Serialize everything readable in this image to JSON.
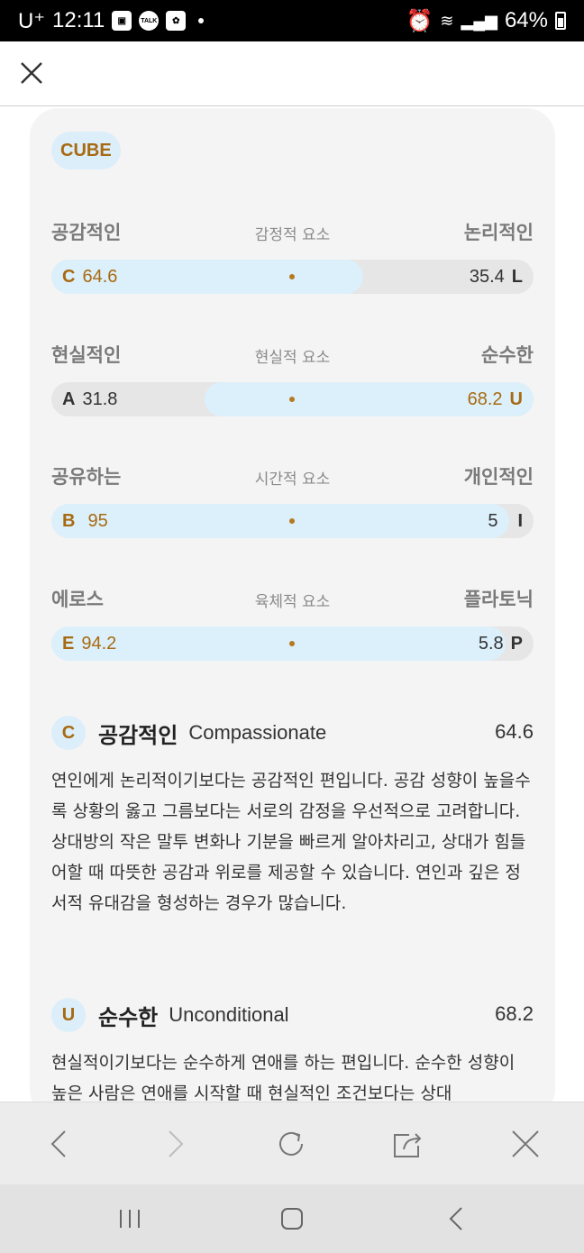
{
  "status_bar": {
    "carrier": "U⁺",
    "time": "12:11",
    "notif_kakao": "TALK",
    "signal_text": "64%"
  },
  "top_bar": {
    "close_icon": "close-icon"
  },
  "badge": "CUBE",
  "axes": [
    {
      "left_label": "공감적인",
      "center_label": "감정적 요소",
      "right_label": "논리적인",
      "left_letter": "C",
      "left_value": "64.6",
      "right_value": "35.4",
      "right_letter": "L",
      "fill_side": "left",
      "fill_percent": 64.6
    },
    {
      "left_label": "현실적인",
      "center_label": "현실적 요소",
      "right_label": "순수한",
      "left_letter": "A",
      "left_value": "31.8",
      "right_value": "68.2",
      "right_letter": "U",
      "fill_side": "right",
      "fill_percent": 68.2
    },
    {
      "left_label": "공유하는",
      "center_label": "시간적 요소",
      "right_label": "개인적인",
      "left_letter": "B",
      "left_value": "95",
      "right_value": "5",
      "right_letter": "I",
      "fill_side": "left",
      "fill_percent": 95
    },
    {
      "left_label": "에로스",
      "center_label": "육체적 요소",
      "right_label": "플라토닉",
      "left_letter": "E",
      "left_value": "94.2",
      "right_value": "5.8",
      "right_letter": "P",
      "fill_side": "left",
      "fill_percent": 94.2
    }
  ],
  "descriptions": [
    {
      "letter": "C",
      "title": "공감적인",
      "english": "Compassionate",
      "score": "64.6",
      "body": "연인에게 논리적이기보다는 공감적인 편입니다. 공감 성향이 높을수록 상황의 옳고 그름보다는 서로의 감정을 우선적으로 고려합니다. 상대방의 작은 말투 변화나 기분을 빠르게 알아차리고, 상대가 힘들어할 때 따뜻한 공감과 위로를 제공할 수 있습니다. 연인과 깊은 정서적 유대감을 형성하는 경우가 많습니다."
    },
    {
      "letter": "U",
      "title": "순수한",
      "english": "Unconditional",
      "score": "68.2",
      "body": "현실적이기보다는 순수하게 연애를 하는 편입니다. 순수한 성향이 높은 사람은 연애를 시작할 때 현실적인 조건보다는 상대"
    }
  ],
  "colors": {
    "accent_gold": "#a86a10",
    "fill_blue": "#dcf0fb",
    "track_gray": "#e6e6e6"
  },
  "toolbar_icons": [
    "back-icon",
    "forward-icon",
    "reload-icon",
    "share-icon",
    "close-icon"
  ],
  "nav_icons": [
    "recent-apps-icon",
    "home-icon",
    "system-back-icon"
  ]
}
